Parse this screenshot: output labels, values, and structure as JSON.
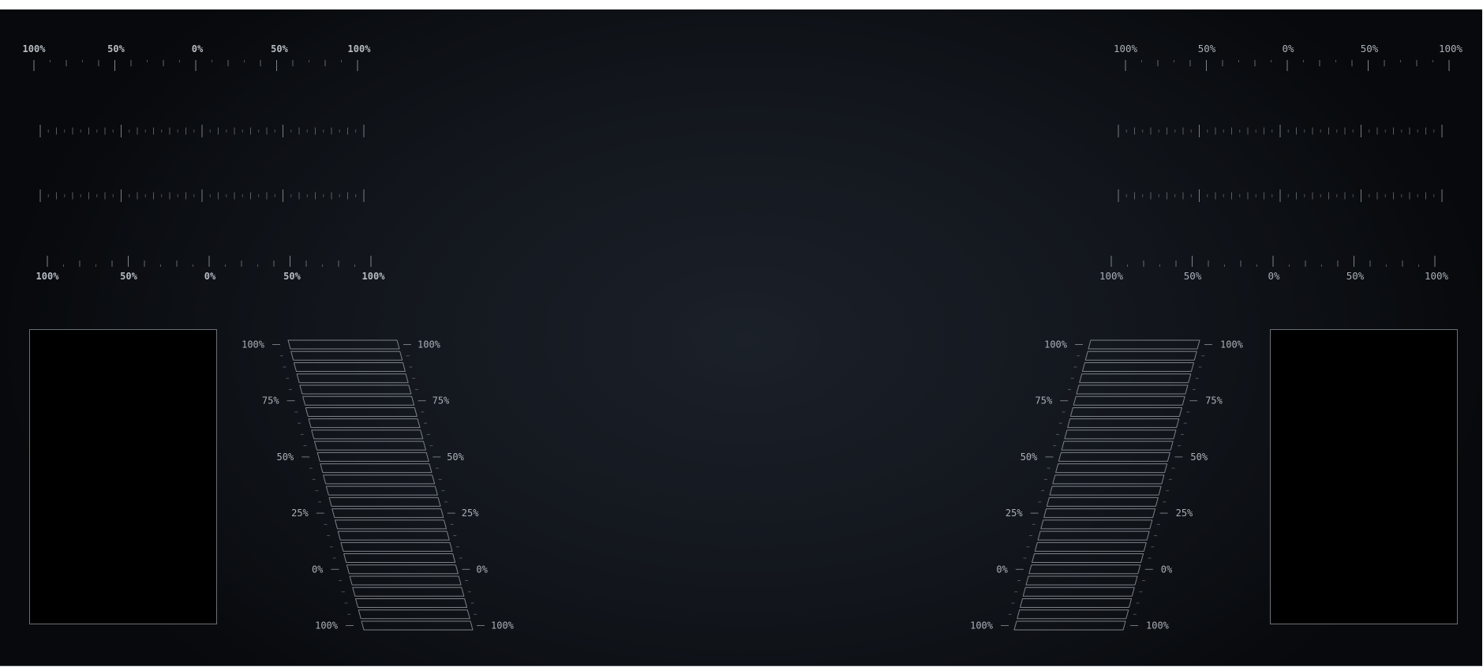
{
  "colors": {
    "background_center": "#1b2029",
    "background_edge": "#07090c",
    "tick": "#8c9199",
    "label": "#aab0b8",
    "bar_outline": "#7d8188",
    "display_fill": "#000000",
    "display_border": "#6b6f76"
  },
  "scales": {
    "left_top_labels": [
      "100%",
      "50%",
      "0%",
      "50%",
      "100%"
    ],
    "left_bottom_labels": [
      "100%",
      "50%",
      "0%",
      "50%",
      "100%"
    ],
    "right_top_labels": [
      "100%",
      "50%",
      "0%",
      "50%",
      "100%"
    ],
    "right_bottom_labels": [
      "100%",
      "50%",
      "0%",
      "50%",
      "100%"
    ]
  },
  "ladders": {
    "left": {
      "outer_labels": [
        "100%",
        "75%",
        "50%",
        "25%",
        "0%",
        "100%"
      ],
      "inner_labels": [
        "100%",
        "75%",
        "50%",
        "25%",
        "0%",
        "100%"
      ],
      "bar_count": 26
    },
    "right": {
      "outer_labels": [
        "100%",
        "75%",
        "50%",
        "25%",
        "0%",
        "100%"
      ],
      "inner_labels": [
        "100%",
        "75%",
        "50%",
        "25%",
        "0%",
        "100%"
      ],
      "bar_count": 26
    }
  },
  "displays": {
    "left": {
      "name": "left-display-panel"
    },
    "right": {
      "name": "right-display-panel"
    }
  }
}
